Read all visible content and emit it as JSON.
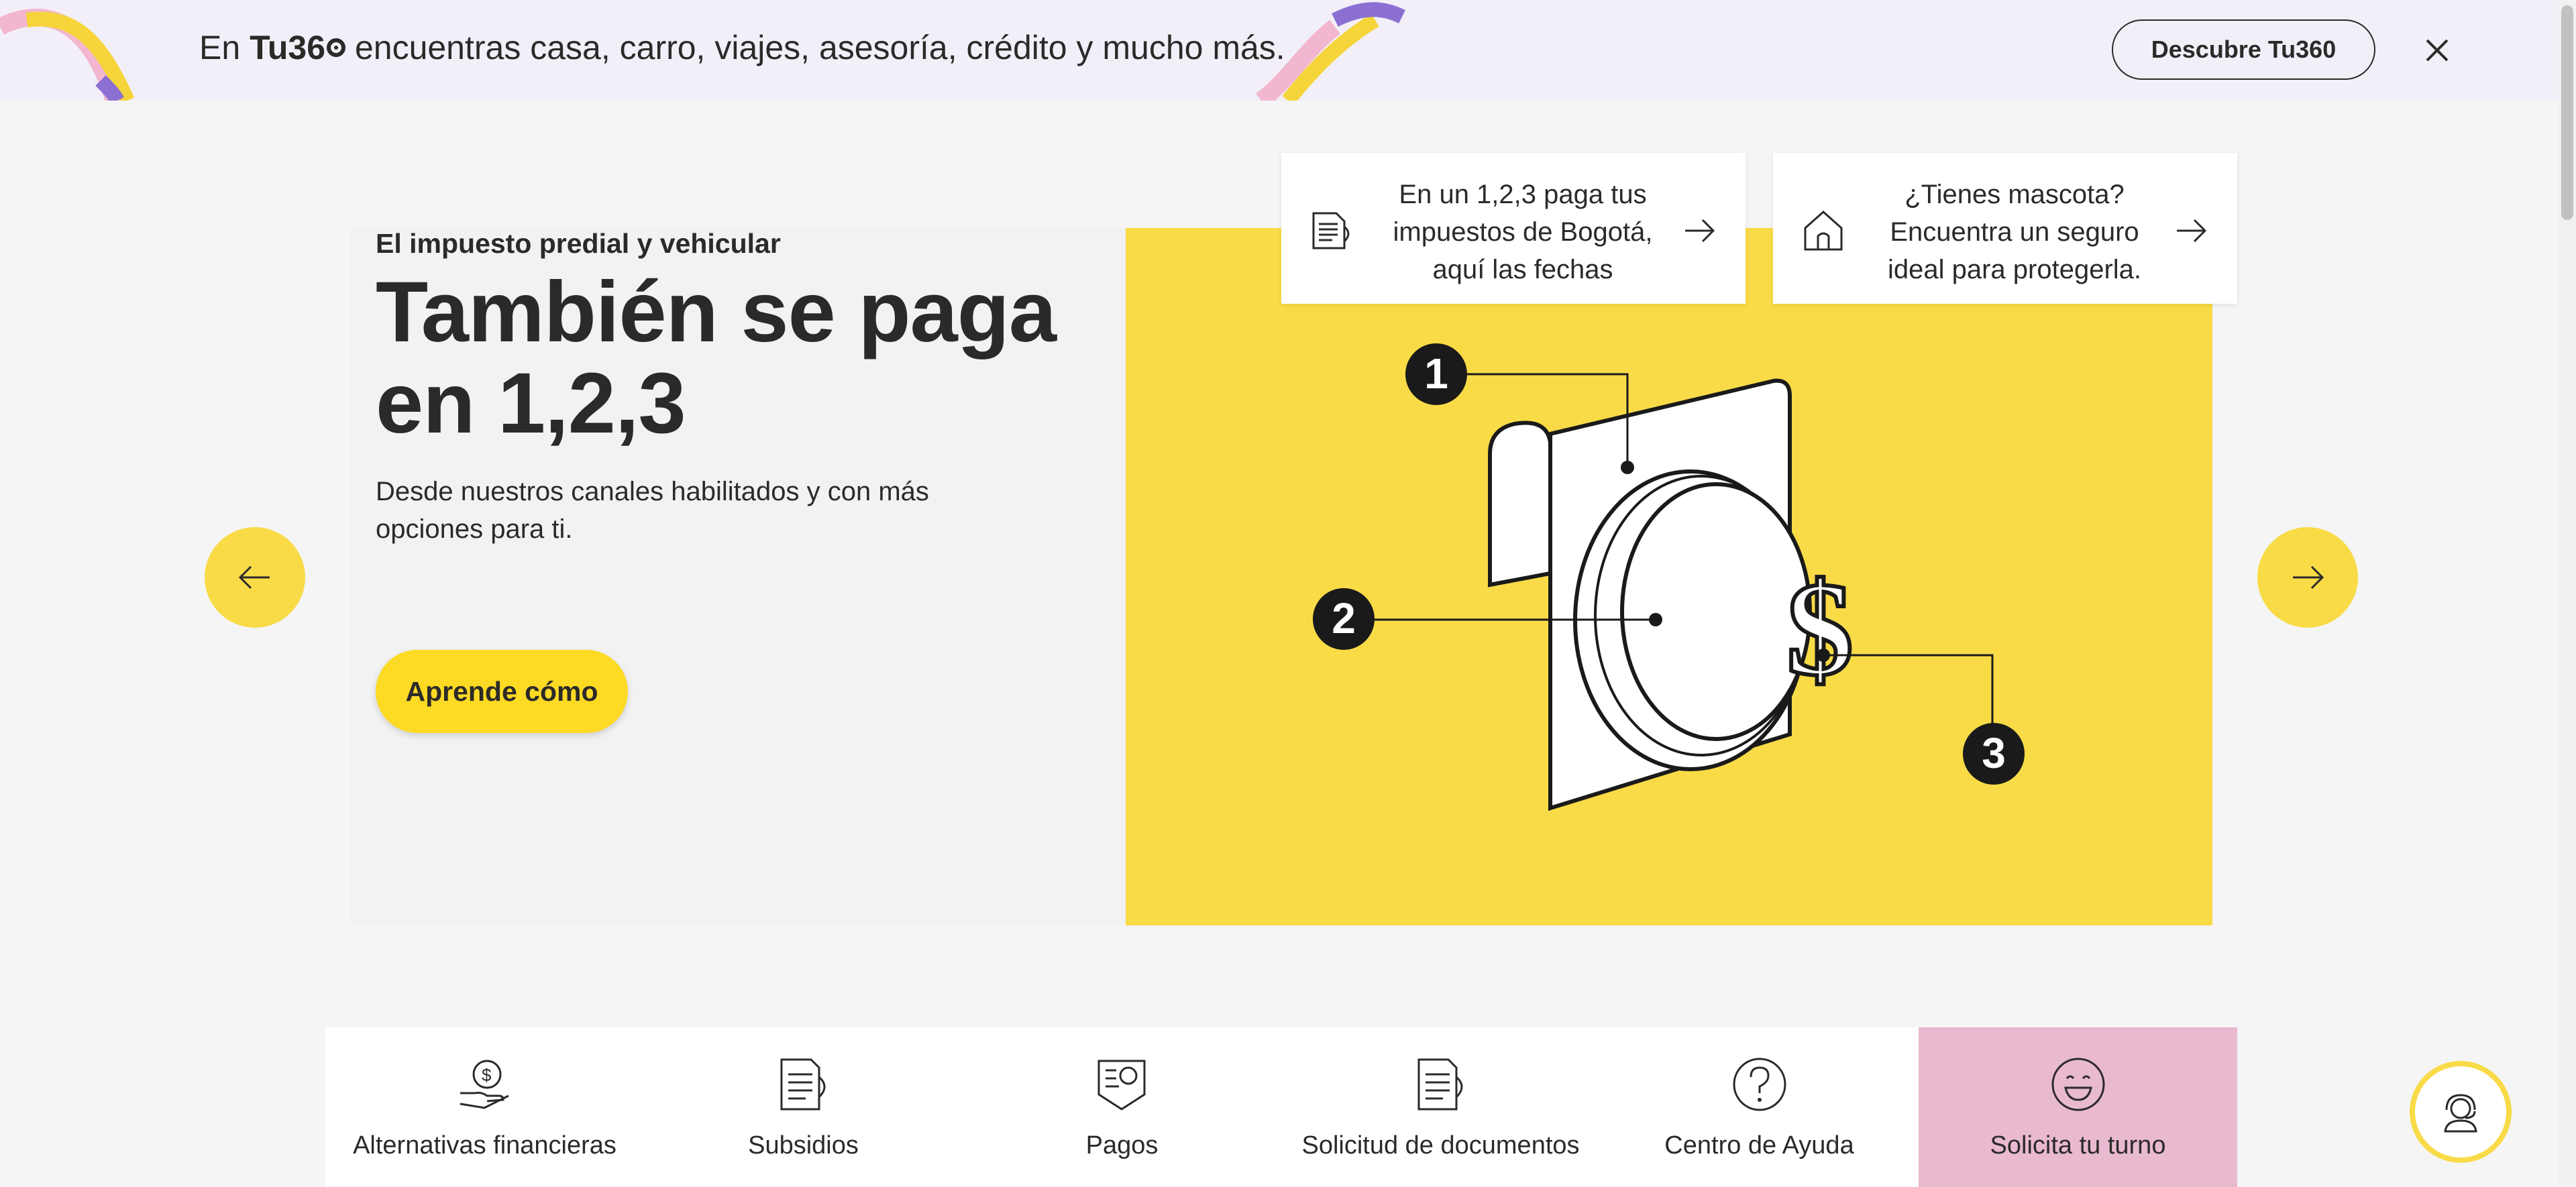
{
  "promo": {
    "text_before": "En ",
    "brand_bold": "Tu36",
    "text_after": " encuentras casa, carro, viajes, asesoría, crédito y mucho más.",
    "button_label": "Descubre Tu360",
    "close_icon": "close-icon"
  },
  "hero": {
    "eyebrow": "El impuesto predial y vehicular",
    "headline": "También se paga en 1,2,3",
    "subtext": "Desde nuestros canales habilitados y con más opciones para ti.",
    "cta_label": "Aprende cómo",
    "illustration_markers": [
      "1",
      "2",
      "3"
    ]
  },
  "cards": [
    {
      "text": "En un 1,2,3 paga tus impuestos de Bogotá, aquí las fechas",
      "icon": "document-icon"
    },
    {
      "text": "¿Tienes mascota? Encuentra un seguro ideal para protegerla.",
      "icon": "house-icon"
    }
  ],
  "menu": [
    {
      "label": "Alternativas financieras",
      "icon": "hand-money-icon"
    },
    {
      "label": "Subsidios",
      "icon": "document-icon"
    },
    {
      "label": "Pagos",
      "icon": "payment-doc-icon"
    },
    {
      "label": "Solicitud de documentos",
      "icon": "document-icon"
    },
    {
      "label": "Centro de Ayuda",
      "icon": "question-icon"
    },
    {
      "label": "Solicita tu turno",
      "icon": "smile-icon",
      "active": true
    }
  ],
  "colors": {
    "brand_yellow": "#fdda24",
    "panel_yellow": "#f8db47",
    "promo_bg": "#f2eff8",
    "active_pink": "#e8b9cf",
    "text_dark": "#2c2a29"
  }
}
